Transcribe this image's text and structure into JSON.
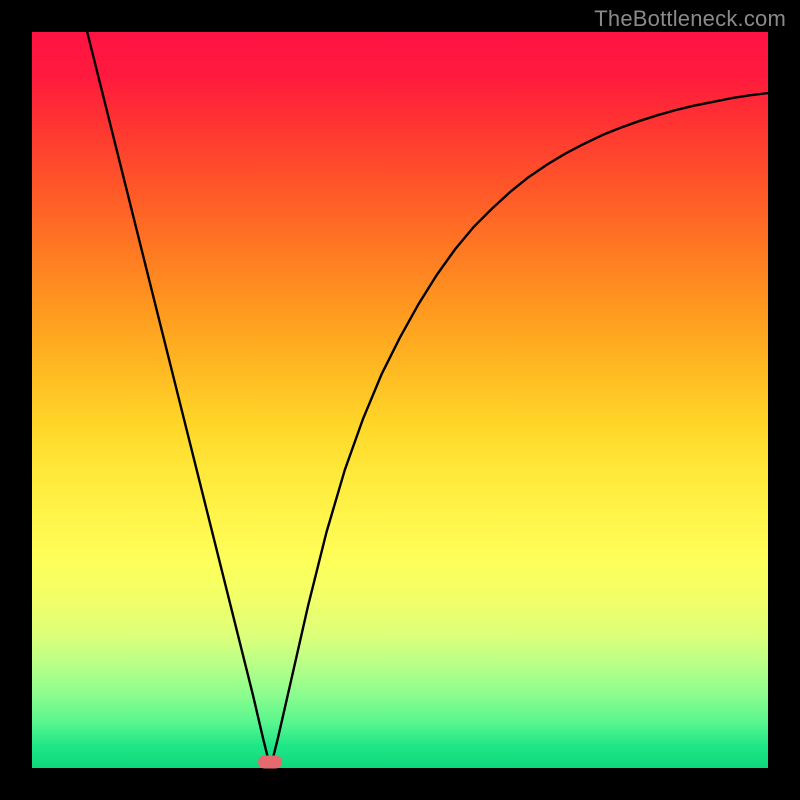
{
  "watermark": "TheBottleneck.com",
  "marker": {
    "x_frac": 0.324,
    "y_frac": 0.992
  },
  "chart_data": {
    "type": "line",
    "title": "",
    "xlabel": "",
    "ylabel": "",
    "xlim": [
      0,
      1
    ],
    "ylim": [
      0,
      100
    ],
    "x": [
      0.075,
      0.1,
      0.125,
      0.15,
      0.175,
      0.2,
      0.225,
      0.25,
      0.275,
      0.3,
      0.314,
      0.324,
      0.334,
      0.35,
      0.375,
      0.4,
      0.425,
      0.45,
      0.475,
      0.5,
      0.525,
      0.55,
      0.575,
      0.6,
      0.625,
      0.65,
      0.675,
      0.7,
      0.725,
      0.75,
      0.775,
      0.8,
      0.825,
      0.85,
      0.875,
      0.9,
      0.925,
      0.95,
      0.975,
      1.0
    ],
    "values": [
      100,
      90,
      80,
      70,
      60,
      50,
      40,
      30,
      20,
      10,
      4,
      0,
      4,
      11,
      22,
      32,
      40.5,
      47.5,
      53.5,
      58.5,
      63,
      67,
      70.5,
      73.5,
      76,
      78.3,
      80.3,
      82,
      83.5,
      84.8,
      86,
      87,
      87.9,
      88.7,
      89.4,
      90,
      90.5,
      91,
      91.4,
      91.7
    ],
    "legend": [],
    "grid": false,
    "annotations": [
      {
        "type": "marker",
        "x": 0.324,
        "y": 0,
        "color": "#e46a6f",
        "shape": "pill"
      }
    ]
  }
}
